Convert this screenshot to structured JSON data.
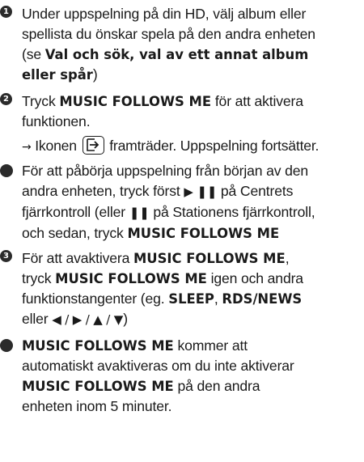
{
  "items": [
    {
      "marker": "1",
      "lines": [
        "Under uppspelning på din HD, välj album eller",
        "spellista du önskar spela på den andra enheten",
        "(se ",
        "Val och sök, val av ett annat album",
        "eller spår",
        ")"
      ]
    },
    {
      "marker": "2",
      "l1_pre": "Tryck ",
      "l1_bold": "MUSIC FOLLOWS ME",
      "l1_post": " för att aktivera",
      "l2": "funktionen.",
      "sub_arrow": "→",
      "sub_pre": " Ikonen ",
      "icon_name": "music-follows-me-icon",
      "sub_post": " framträder. Uppspelning fortsätter."
    },
    {
      "marker": "•",
      "l1": "För att påbörja uppspelning från början av den",
      "l2_pre": "andra enheten, tryck först ",
      "l2_sym": "▶ ❚❚",
      "l2_post": " på Centrets",
      "l3_pre": "fjärrkontroll (eller ",
      "l3_sym": "❚❚",
      "l3_post": " på Stationens fjärrkontroll,",
      "l4_pre": "och sedan, tryck ",
      "l4_bold": "MUSIC FOLLOWS ME"
    },
    {
      "marker": "3",
      "l1_pre": "För att avaktivera ",
      "l1_bold": "MUSIC FOLLOWS ME",
      "l1_post": ",",
      "l2_pre": "tryck ",
      "l2_bold": "MUSIC FOLLOWS ME",
      "l2_post": " igen och andra",
      "l3_pre": "funktionstangenter (eg. ",
      "l3_b1": "SLEEP",
      "l3_mid": ", ",
      "l3_b2": "RDS/NEWS",
      "l4_pre": "eller ",
      "l4_sym": "◀ / ▶ / ▲ / ▼",
      "l4_post": ")"
    },
    {
      "marker": "•",
      "l1_bold": "MUSIC FOLLOWS ME",
      "l1_post": " kommer att",
      "l2": "automatiskt avaktiveras om du inte aktiverar",
      "l3_bold": "MUSIC FOLLOWS ME",
      "l3_post": " på den andra",
      "l4": "enheten inom 5 minuter."
    }
  ],
  "colors": {
    "text": "#1a1a1a",
    "marker_bg": "#2b2b2b"
  }
}
